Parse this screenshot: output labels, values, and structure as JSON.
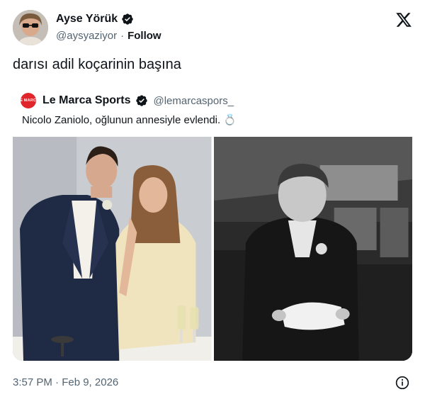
{
  "author": {
    "display_name": "Ayse Yörük",
    "handle": "@aysyaziyor",
    "separator": "·",
    "follow_label": "Follow"
  },
  "tweet": {
    "text": "darısı adil koçarinin başına",
    "timestamp": "3:57 PM · Feb 9, 2026"
  },
  "quoted": {
    "display_name": "Le Marca Sports",
    "handle": "@lemarcaspors_",
    "avatar_text": "LE MARCA",
    "text": "Nicolo Zaniolo, oğlunun annesiyle evlendi. 💍"
  },
  "media": [
    {
      "icon": "wedding-couple-photo"
    },
    {
      "icon": "ring-bearer-boy-photo"
    }
  ],
  "colors": {
    "verified": "#0f1419",
    "secondary_text": "#536471",
    "quote_avatar": "#e0262b"
  }
}
